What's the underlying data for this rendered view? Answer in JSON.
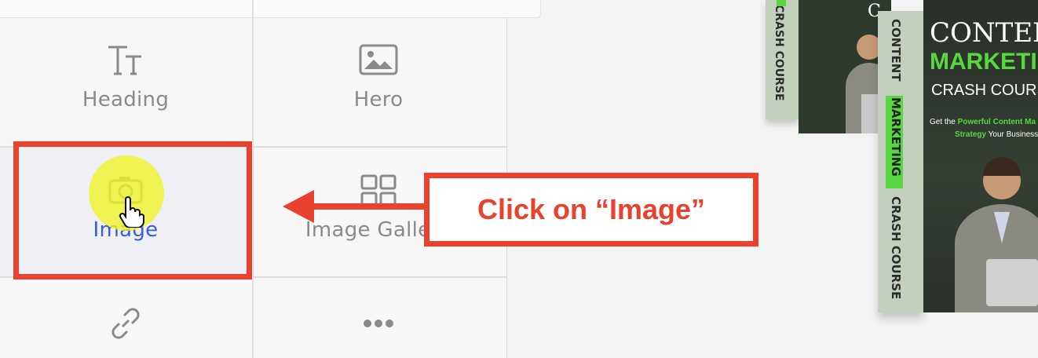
{
  "blocks": {
    "heading": {
      "label": "Heading",
      "icon": "heading-icon"
    },
    "hero": {
      "label": "Hero",
      "icon": "image-icon"
    },
    "image": {
      "label": "Image",
      "icon": "camera-icon",
      "selected": true
    },
    "gallery": {
      "label": "Image Gallery",
      "icon": "grid-icon"
    },
    "link": {
      "label": "",
      "icon": "link-icon"
    },
    "more": {
      "label": "",
      "icon": "more-icon"
    }
  },
  "callout": {
    "text": "Click on “Image”",
    "color": "#e8422e"
  },
  "product": {
    "spine_back_1": "CRASH COURSE",
    "spine_front_1": "CONTENT",
    "spine_front_2": "MARKETING",
    "spine_front_3": "CRASH COURSE",
    "cover_letter": "C",
    "cover_title": "CONTEN",
    "cover_green": "MARKETIN",
    "cover_sub": "CRASH COURS",
    "cover_tag_1": "Get the",
    "cover_tag_bold": "Powerful Content Ma",
    "cover_tag_2": "Strategy",
    "cover_tag_3": "Your Business Ne"
  },
  "colors": {
    "accent": "#e8422e",
    "selected_label": "#3b5bdb",
    "highlight": "#eef324",
    "product_green": "#58d840"
  }
}
